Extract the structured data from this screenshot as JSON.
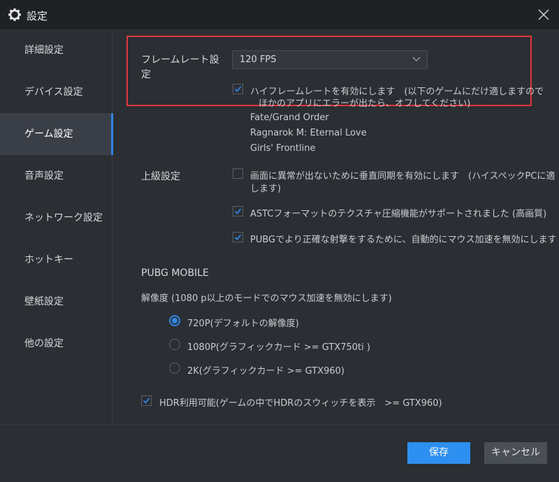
{
  "window": {
    "title": "設定",
    "title_icon": "gear-icon",
    "close_icon": "close-icon"
  },
  "sidebar": {
    "items": [
      {
        "label": "詳細設定"
      },
      {
        "label": "デバイス設定"
      },
      {
        "label": "ゲーム設定"
      },
      {
        "label": "音声設定"
      },
      {
        "label": "ネットワーク設定"
      },
      {
        "label": "ホットキー"
      },
      {
        "label": "壁紙設定"
      },
      {
        "label": "他の設定"
      }
    ],
    "active": "ゲーム設定"
  },
  "framerate": {
    "label_line1": "フレームレート設",
    "label_line2": "定",
    "selected": "120 FPS",
    "high_fps": {
      "checked": true,
      "text_line1": "ハイフレームレートを有効にします　(以下のゲームにだけ適しますので",
      "text_line2": "ほかのアプリにエラーが出たら、オフしてください)"
    },
    "games": [
      "Fate/Grand Order",
      "Ragnarok M: Eternal Love",
      "Girls' Frontline"
    ]
  },
  "advanced": {
    "label": "上級設定",
    "options": [
      {
        "checked": false,
        "text_line1": "画面に異常が出ないために垂直同期を有効にします　(ハイスペックPCに適",
        "text_line2": "します)"
      },
      {
        "checked": true,
        "text_line1": "ASTCフォーマットのテクスチャ圧縮機能がサポートされました (高画質)",
        "text_line2": ""
      },
      {
        "checked": true,
        "text_line1": "PUBGでより正確な射撃をするために、自動的にマウス加速を無効にします",
        "text_line2": ""
      }
    ]
  },
  "pubg": {
    "heading": "PUBG MOBILE",
    "resolution_label": "解像度 (1080 p以上のモードでのマウス加速を無効にします)",
    "resolutions": [
      {
        "label": "720P(デフォルトの解像度)",
        "selected": true
      },
      {
        "label": "1080P(グラフィックカード >= GTX750ti )",
        "selected": false
      },
      {
        "label": "2K(グラフィックカード >= GTX960)",
        "selected": false
      }
    ],
    "hdr": {
      "checked": true,
      "label": "HDR利用可能(ゲームの中でHDRのスウィッチを表示　>= GTX960)"
    }
  },
  "footer": {
    "save_label": "保存",
    "cancel_label": "キャンセル"
  },
  "colors": {
    "accent": "#2f87e4",
    "highlight_border": "#e0383b",
    "save_button": "#2d8ff0"
  }
}
